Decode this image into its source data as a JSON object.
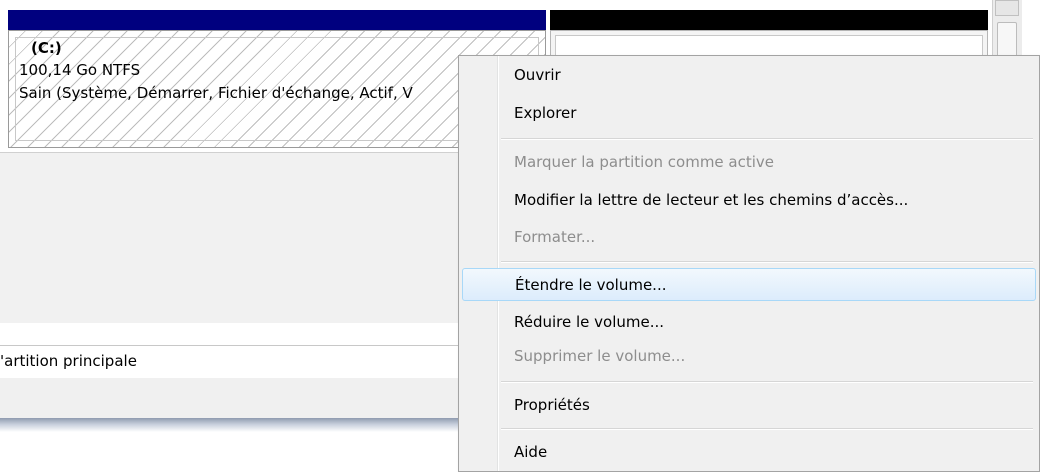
{
  "window": {
    "accent_navy": "#00007f",
    "accent_black": "#000000"
  },
  "volume_c": {
    "drive_label": "(C:)",
    "size_fs": "100,14 Go NTFS",
    "status": "Sain (Système, Démarrer, Fichier d'échange, Actif, V"
  },
  "partition_type": "'artition principale",
  "context_menu": {
    "items": [
      {
        "label": "Ouvrir",
        "enabled": true
      },
      {
        "label": "Explorer",
        "enabled": true
      },
      {
        "label": "Marquer la partition comme active",
        "enabled": false
      },
      {
        "label": "Modifier la lettre de lecteur et les chemins d’accès...",
        "enabled": true
      },
      {
        "label": "Formater...",
        "enabled": false
      },
      {
        "label": "Étendre le volume...",
        "enabled": true,
        "highlighted": true
      },
      {
        "label": "Réduire le volume...",
        "enabled": true
      },
      {
        "label": "Supprimer le volume...",
        "enabled": false
      },
      {
        "label": "Propriétés",
        "enabled": true
      },
      {
        "label": "Aide",
        "enabled": true
      }
    ]
  }
}
